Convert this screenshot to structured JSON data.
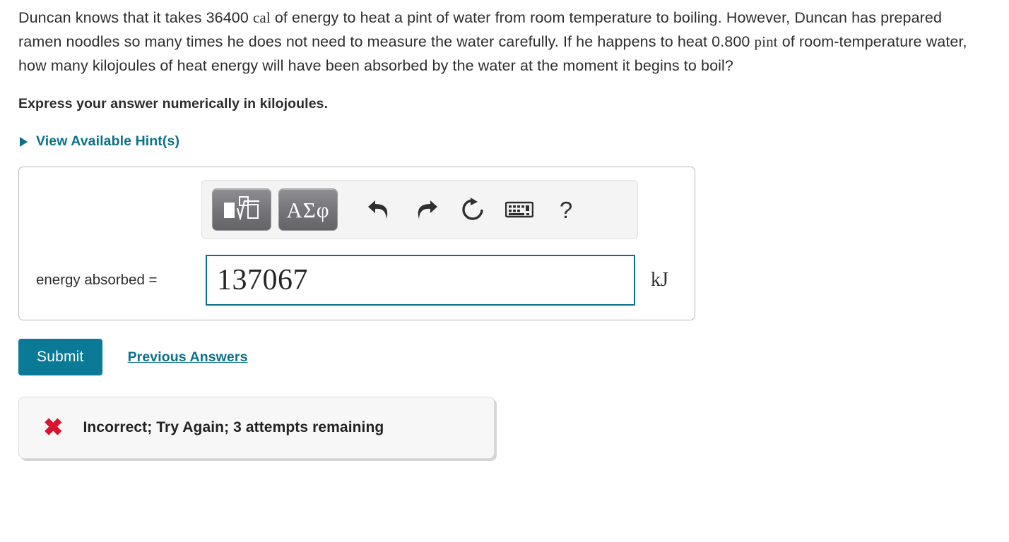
{
  "problem": {
    "text_part_1": "Duncan knows that it takes 36400",
    "unit_cal": "cal",
    "text_part_2": "of energy to heat a pint of water from room temperature to boiling. However, Duncan has prepared ramen noodles so many times he does not need to measure the water carefully. If he happens to heat 0.800",
    "unit_pint": "pint",
    "text_part_3": "of room-temperature water, how many kilojoules of heat energy will have been absorbed by the water at the moment it begins to boil?",
    "instruction": "Express your answer numerically in kilojoules."
  },
  "hints": {
    "label": "View Available Hint(s)",
    "caret": "triangle-right-icon"
  },
  "toolbar": {
    "template_button": "math-template-icon",
    "greek_button_label": "ΑΣφ",
    "undo": "undo-icon",
    "redo": "redo-icon",
    "reset": "reset-icon",
    "keyboard": "keyboard-icon",
    "help": "?"
  },
  "answer": {
    "label": "energy absorbed =",
    "value": "137067",
    "placeholder": "",
    "unit": "kJ"
  },
  "actions": {
    "submit_label": "Submit",
    "previous_answers_label": "Previous Answers"
  },
  "feedback": {
    "icon": "x-mark-icon",
    "message": "Incorrect; Try Again; 3 attempts remaining"
  },
  "colors": {
    "accent_teal": "#0b7189",
    "submit_teal": "#0a7a96",
    "error_red": "#d8152f",
    "text": "#2d2d2d"
  }
}
